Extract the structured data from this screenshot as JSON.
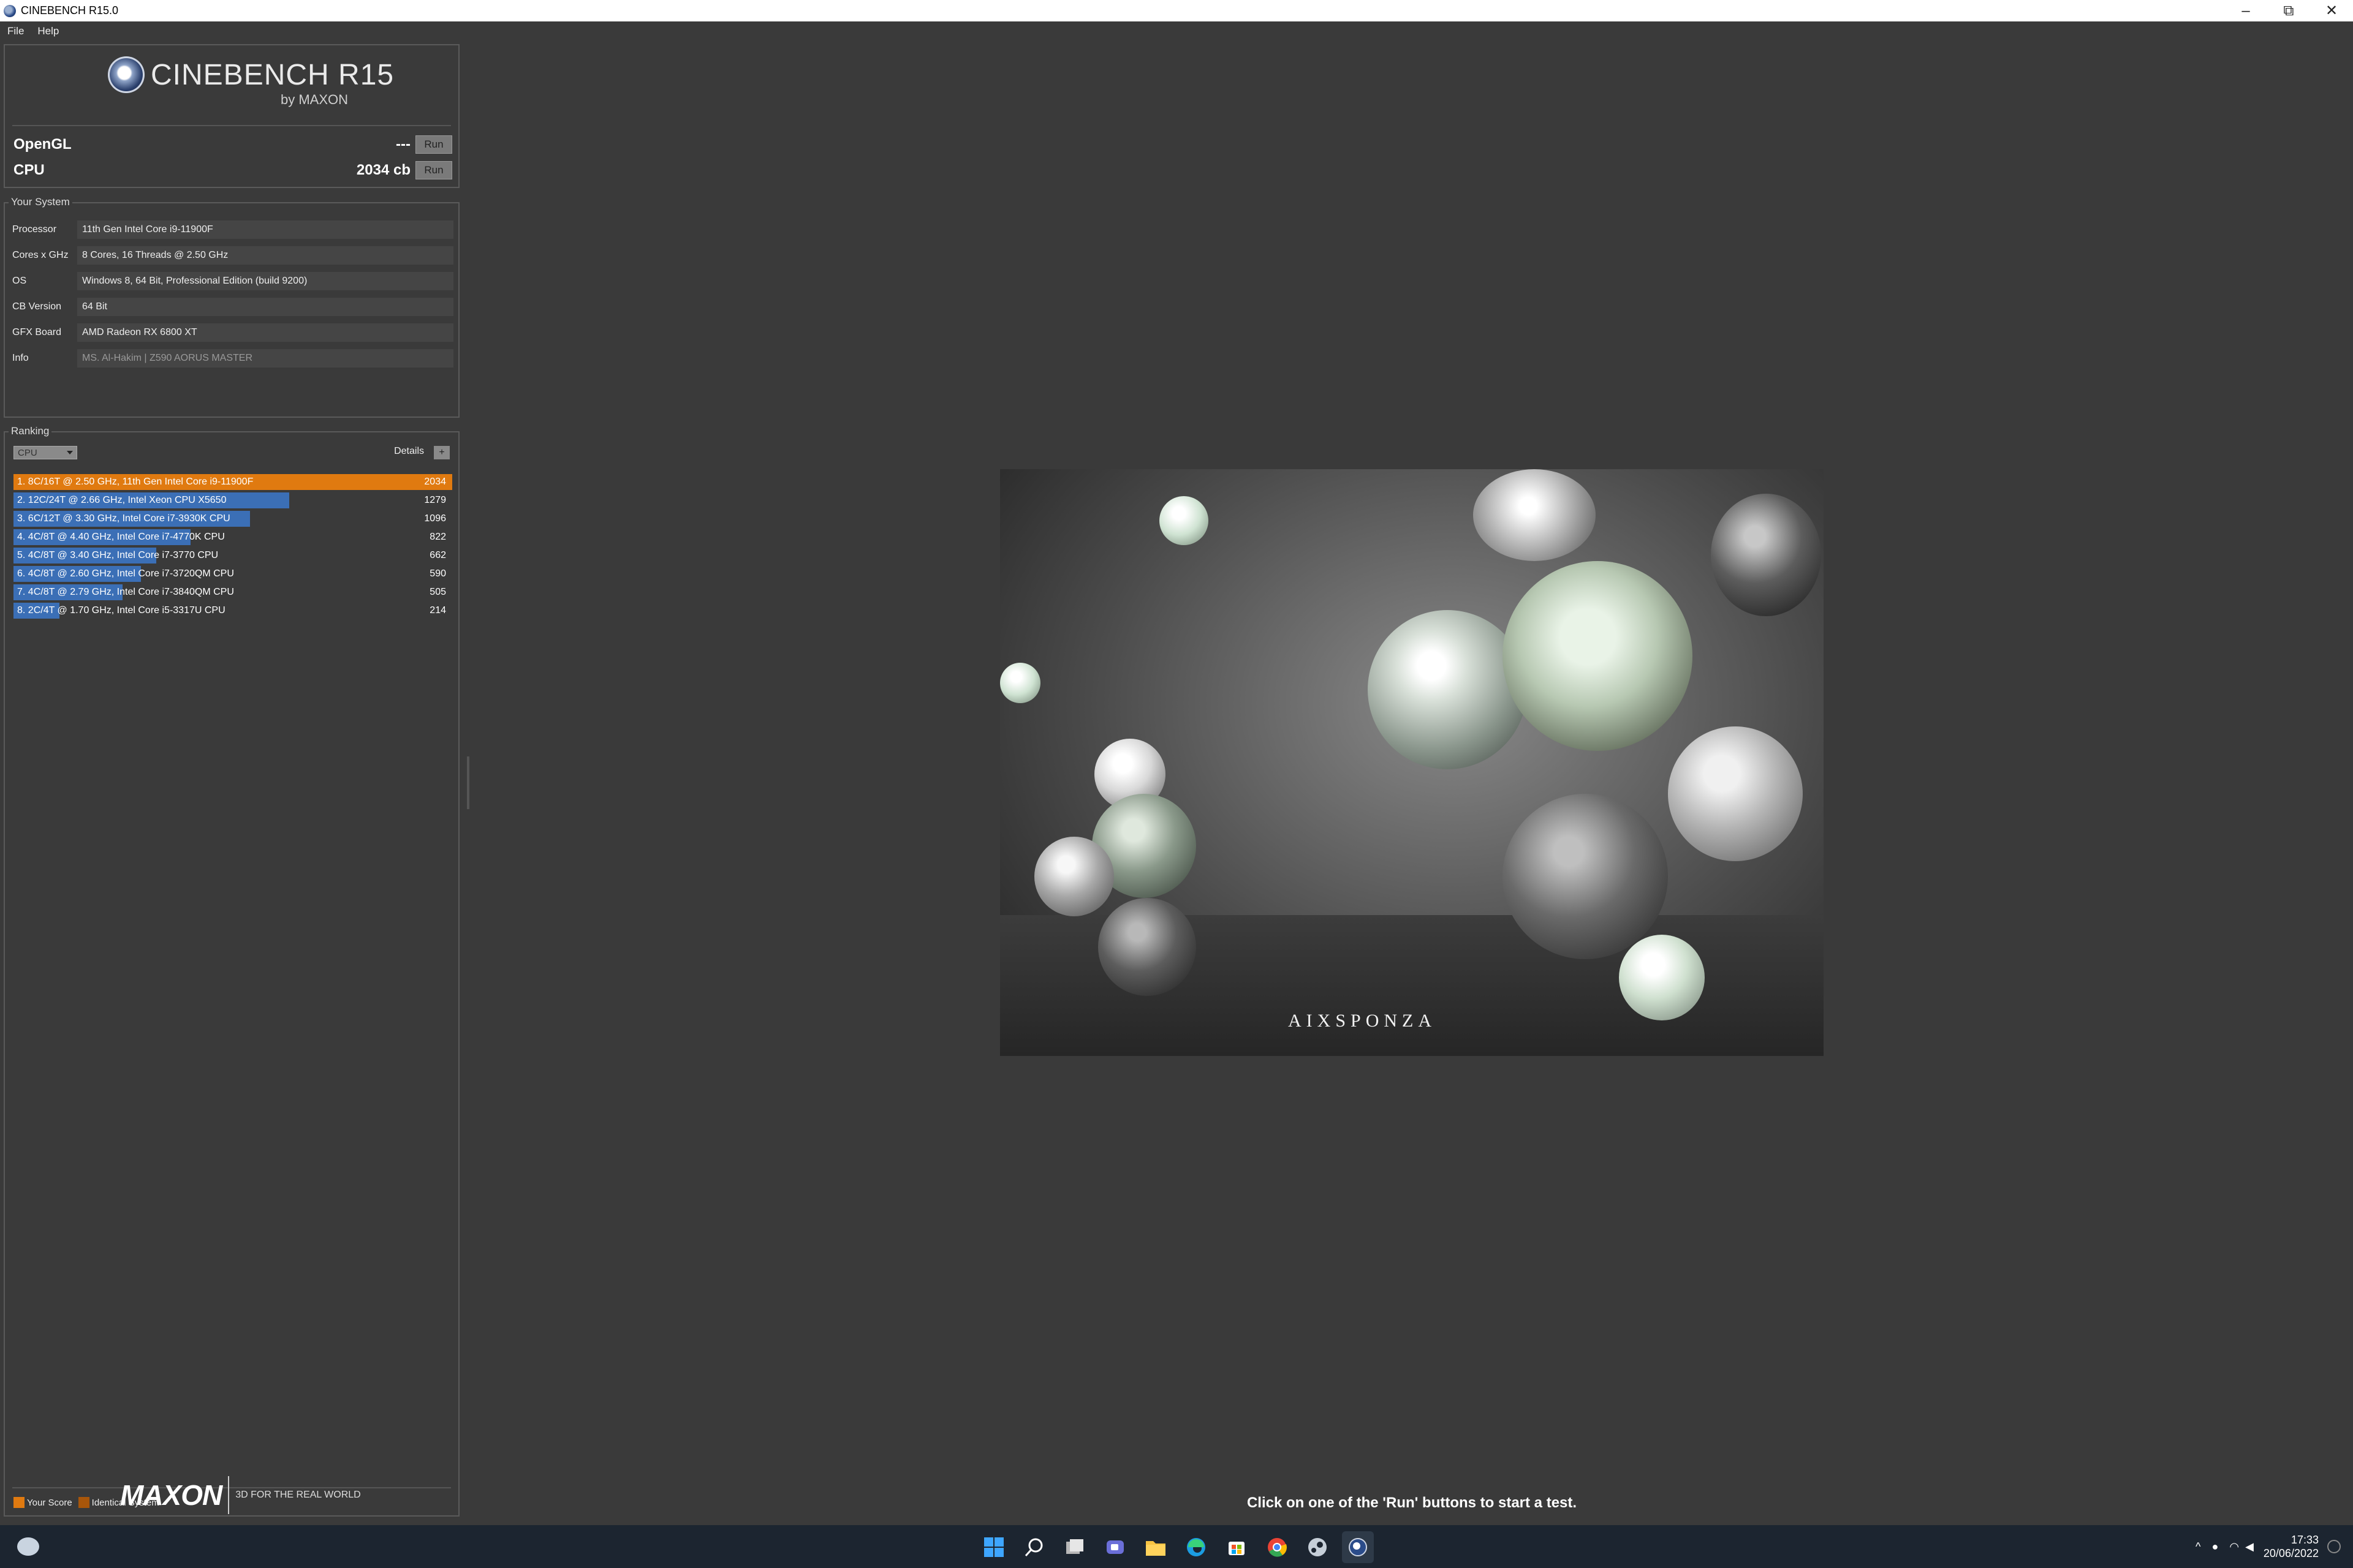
{
  "window": {
    "title": "CINEBENCH R15.0",
    "controls": [
      "–",
      "⧉",
      "✕"
    ]
  },
  "menu": {
    "items": [
      "File",
      "Help"
    ]
  },
  "logo": {
    "name": "CINEBENCH R15",
    "byline": "by MAXON"
  },
  "benchmarks": {
    "opengl": {
      "label": "OpenGL",
      "score": "---",
      "run_label": "Run"
    },
    "cpu": {
      "label": "CPU",
      "score": "2034 cb",
      "run_label": "Run"
    }
  },
  "system": {
    "title": "Your System",
    "rows": [
      {
        "key": "Processor",
        "value": "11th Gen Intel Core i9-11900F"
      },
      {
        "key": "Cores x GHz",
        "value": "8 Cores, 16 Threads @ 2.50 GHz"
      },
      {
        "key": "OS",
        "value": "Windows 8, 64 Bit, Professional Edition (build 9200)"
      },
      {
        "key": "CB Version",
        "value": "64 Bit"
      },
      {
        "key": "GFX Board",
        "value": "AMD Radeon RX 6800 XT"
      },
      {
        "key": "Info",
        "value": "MS. Al-Hakim | Z590 AORUS MASTER"
      }
    ]
  },
  "ranking": {
    "title": "Ranking",
    "selector": "CPU",
    "details_label": "Details",
    "details_button": "+",
    "max_score": 2034,
    "rows": [
      {
        "label": "1. 8C/16T @ 2.50 GHz, 11th Gen Intel Core i9-11900F",
        "score": "2034",
        "value": 2034,
        "mine": true
      },
      {
        "label": "2. 12C/24T @ 2.66 GHz, Intel Xeon CPU X5650",
        "score": "1279",
        "value": 1279
      },
      {
        "label": "3. 6C/12T @ 3.30 GHz,  Intel Core i7-3930K CPU",
        "score": "1096",
        "value": 1096
      },
      {
        "label": "4. 4C/8T @ 4.40 GHz, Intel Core i7-4770K CPU",
        "score": "822",
        "value": 822
      },
      {
        "label": "5. 4C/8T @ 3.40 GHz,  Intel Core i7-3770 CPU",
        "score": "662",
        "value": 662
      },
      {
        "label": "6. 4C/8T @ 2.60 GHz, Intel Core i7-3720QM CPU",
        "score": "590",
        "value": 590
      },
      {
        "label": "7. 4C/8T @ 2.79 GHz,  Intel Core i7-3840QM CPU",
        "score": "505",
        "value": 505
      },
      {
        "label": "8. 2C/4T @ 1.70 GHz,  Intel Core i5-3317U CPU",
        "score": "214",
        "value": 214
      }
    ],
    "legend": {
      "your_score": "Your Score",
      "identical": "Identical System"
    }
  },
  "footer": {
    "brand": "MAXON",
    "tagline": "3D FOR THE REAL WORLD"
  },
  "preview": {
    "watermark": "AIXSPONZA"
  },
  "hint": "Click on one of the 'Run' buttons to start a test.",
  "taskbar": {
    "apps": [
      "start-icon",
      "search-icon",
      "task-view-icon",
      "chat-icon",
      "file-explorer-icon",
      "edge-icon",
      "store-icon",
      "chrome-icon",
      "steam-icon",
      "cinebench-icon"
    ],
    "time": "17:33",
    "date": "20/06/2022"
  },
  "colors": {
    "your_score": "#e07a10",
    "identical": "#a8560a",
    "bar": "#3b6fb6",
    "background": "#3a3a3a"
  }
}
